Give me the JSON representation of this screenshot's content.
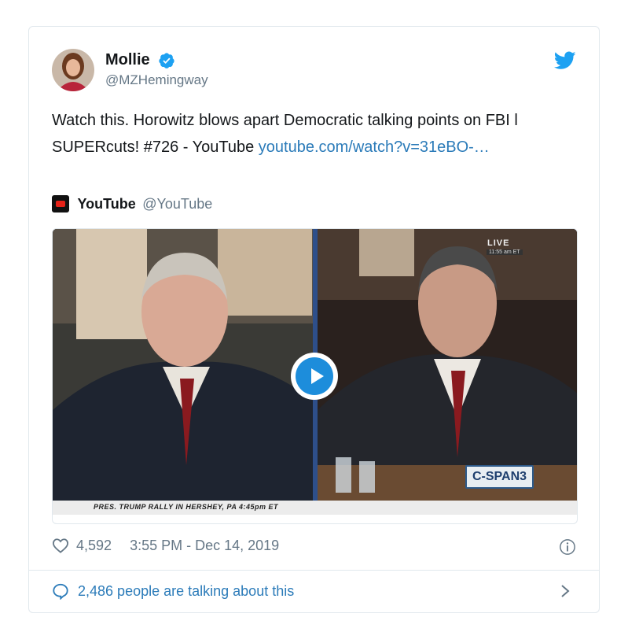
{
  "author": {
    "display_name": "Mollie",
    "handle": "@MZHemingway"
  },
  "tweet": {
    "text": "Watch this. Horowitz blows apart Democratic talking points on FBI l SUPERcuts! #726 - YouTube ",
    "link_text": "youtube.com/watch?v=31eBO-…"
  },
  "quoted": {
    "name": "YouTube",
    "handle": "@YouTube"
  },
  "media": {
    "live_label": "LIVE",
    "live_time": "11:55 am ET",
    "network_label": "C-SPAN3",
    "caption": "PRES. TRUMP RALLY IN HERSHEY, PA 4:45pm ET"
  },
  "meta": {
    "likes": "4,592",
    "timestamp": "3:55 PM - Dec 14, 2019"
  },
  "footer": {
    "talking": "2,486 people are talking about this"
  },
  "colors": {
    "link": "#2b7bb9",
    "verified": "#1da1f2",
    "muted": "#657786"
  },
  "icons": [
    "verified-icon",
    "twitter-bird-icon",
    "youtube-logo-icon",
    "play-icon",
    "heart-icon",
    "info-icon",
    "speech-bubble-icon",
    "chevron-right-icon"
  ]
}
